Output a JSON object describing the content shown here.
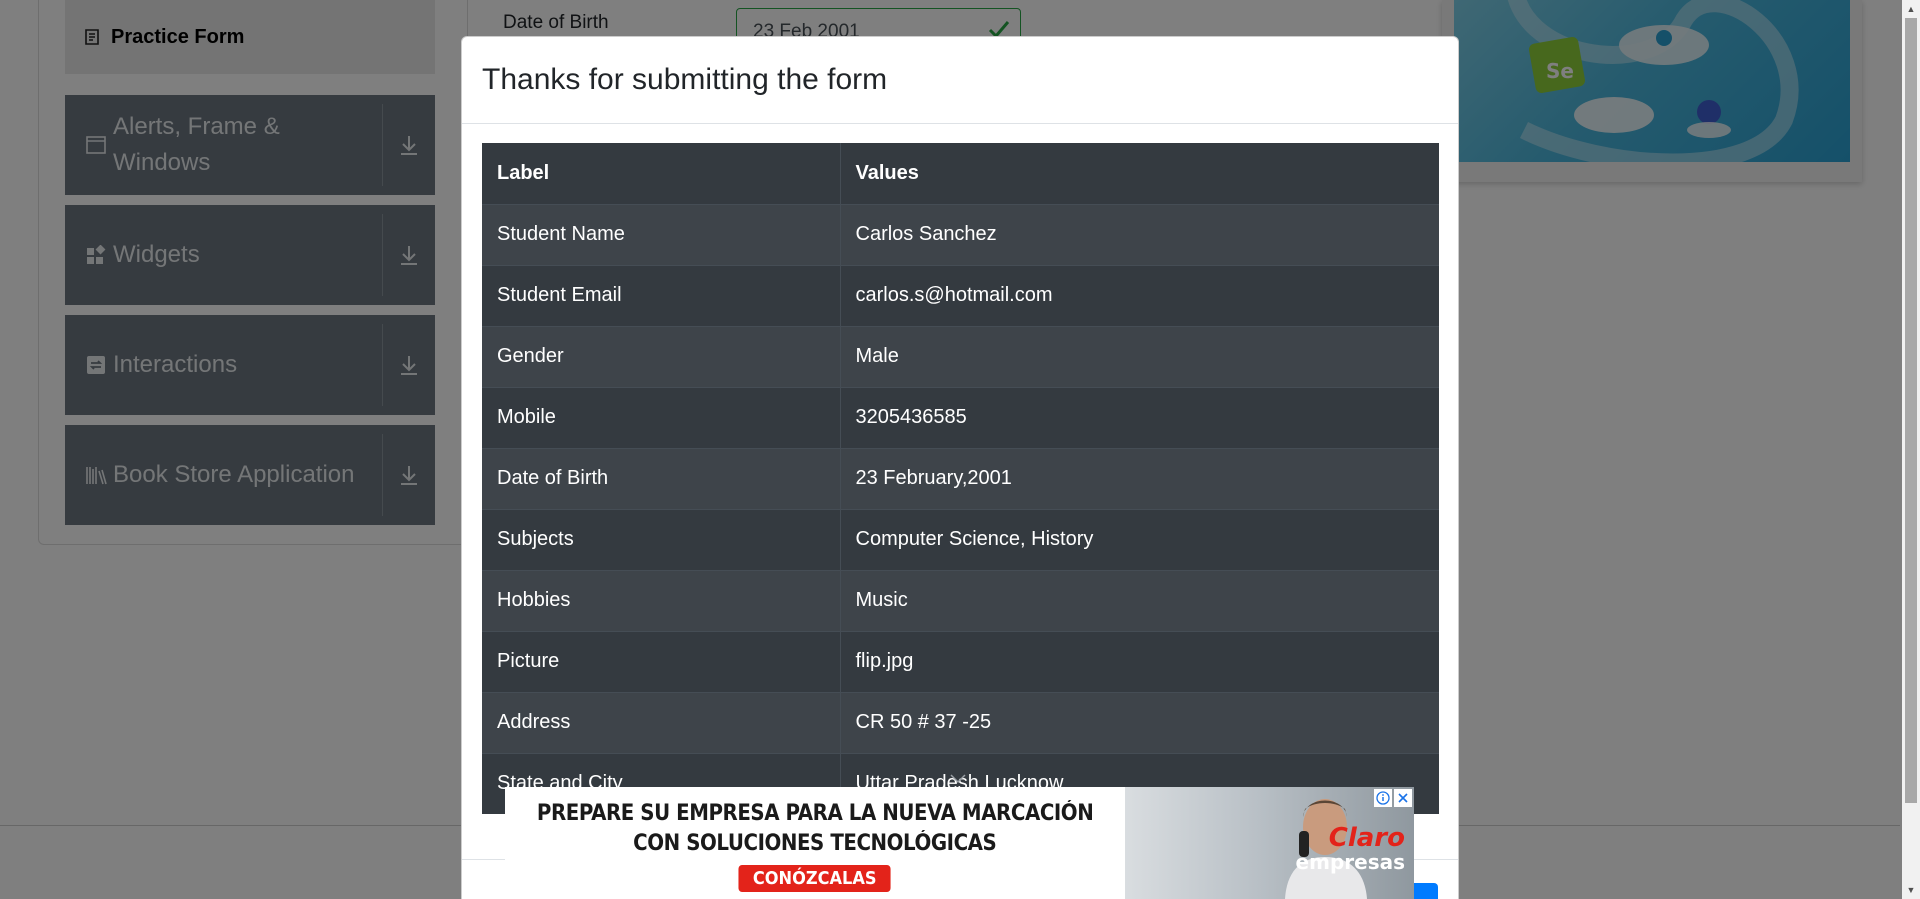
{
  "sidebar": {
    "active_item": "Practice Form",
    "groups": [
      {
        "label": "Alerts, Frame & Windows",
        "icon": "window-icon"
      },
      {
        "label": "Widgets",
        "icon": "widgets-icon"
      },
      {
        "label": "Interactions",
        "icon": "interactions-icon"
      },
      {
        "label": "Book Store Application",
        "icon": "books-icon"
      }
    ]
  },
  "form": {
    "dob_label": "Date of Birth",
    "dob_value": "23 Feb 2001"
  },
  "modal": {
    "title": "Thanks for submitting the form",
    "headers": {
      "label": "Label",
      "values": "Values"
    },
    "rows": [
      {
        "label": "Student Name",
        "value": "Carlos Sanchez"
      },
      {
        "label": "Student Email",
        "value": "carlos.s@hotmail.com"
      },
      {
        "label": "Gender",
        "value": "Male"
      },
      {
        "label": "Mobile",
        "value": "3205436585"
      },
      {
        "label": "Date of Birth",
        "value": "23 February,2001"
      },
      {
        "label": "Subjects",
        "value": "Computer Science, History"
      },
      {
        "label": "Hobbies",
        "value": "Music"
      },
      {
        "label": "Picture",
        "value": "flip.jpg"
      },
      {
        "label": "Address",
        "value": "CR 50 # 37 -25"
      },
      {
        "label": "State and City",
        "value": "Uttar Pradesh Lucknow"
      }
    ]
  },
  "ad": {
    "line1": "PREPARE SU EMPRESA PARA LA NUEVA MARCACIÓN",
    "line2": "CON SOLUCIONES TECNOLÓGICAS",
    "cta": "CONÓZCALAS",
    "brand": "Claro",
    "brand_sub": "empresas"
  },
  "colors": {
    "primary": "#007bff",
    "table_dark": "#343a40",
    "sidebar_group": "#6d7780",
    "success": "#28a745",
    "ad_red": "#e3231a"
  }
}
